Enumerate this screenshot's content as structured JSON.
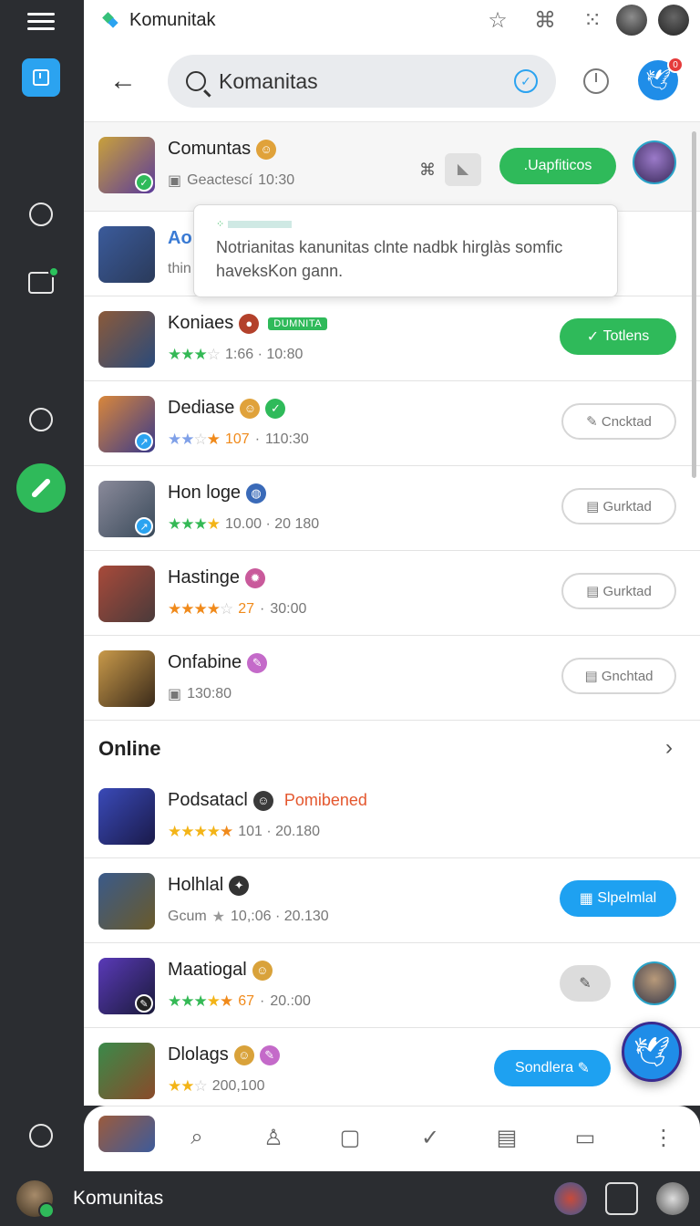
{
  "app": {
    "title": "Komunitak"
  },
  "search": {
    "value": "Komanitas"
  },
  "notification_badge": "0",
  "tooltip": {
    "body": "Notrianitas kanunitas clnte nadbk hirglàs somfic haveksKon gann."
  },
  "rows": [
    {
      "title": "Comuntas",
      "meta": "Geactescí",
      "time": "10:30",
      "action": ".Uapfiticos",
      "thumb_colors": [
        "#c9a13b",
        "#5b3b9b"
      ]
    },
    {
      "title": "Ao",
      "meta": "thin",
      "thumb_colors": [
        "#3b5b9b",
        "#2a3a5a"
      ]
    },
    {
      "title": "Koniaes",
      "tag": "DUMNITA",
      "meta": "1:66 · 10:80",
      "action": "Totlens",
      "thumb_colors": [
        "#8b5a3a",
        "#2a4a7a"
      ]
    },
    {
      "title": "Dediase",
      "meta_orange": "107",
      "meta": "110:30",
      "action": "Cncktad",
      "thumb_colors": [
        "#d9873b",
        "#3a3a8a"
      ]
    },
    {
      "title": "Hon loge",
      "meta": "10.00 · 20 180",
      "action": "Gurktad",
      "thumb_colors": [
        "#8a8a9a",
        "#3a4a5a"
      ]
    },
    {
      "title": "Hastinge",
      "meta_orange": "27",
      "meta": "30:00",
      "action": "Gurktad",
      "thumb_colors": [
        "#a84a3a",
        "#4a3a3a"
      ]
    },
    {
      "title": "Onfabine",
      "meta": "130:80",
      "action": "Gnchtad",
      "thumb_colors": [
        "#c99a4a",
        "#3a2a1a"
      ]
    }
  ],
  "online_section": {
    "label": "Online"
  },
  "online_rows": [
    {
      "title": "Podsatacl",
      "status": "Pomibened",
      "meta": "101 · 20.180",
      "thumb_colors": [
        "#3a4ab8",
        "#1a1a4a"
      ]
    },
    {
      "title": "Holhlal",
      "meta_prefix": "Gcum",
      "meta": "10,:06 · 20.130",
      "action": "Slpelmlal",
      "thumb_colors": [
        "#3a5a8a",
        "#6a5a2a"
      ]
    },
    {
      "title": "Maatiogal",
      "meta_orange": "67",
      "meta": "20.:00",
      "thumb_colors": [
        "#5a3ab8",
        "#1a1a3a"
      ]
    },
    {
      "title": "Dlolags",
      "meta": "200,100",
      "action": "Sondlera",
      "thumb_colors": [
        "#3a8a4a",
        "#8a4a2a"
      ]
    }
  ],
  "status_bar": {
    "title": "Komunitas"
  },
  "colors": {
    "accent_green": "#2fba5a",
    "accent_blue": "#1ea1f1",
    "rail_bg": "#2b2d31"
  }
}
